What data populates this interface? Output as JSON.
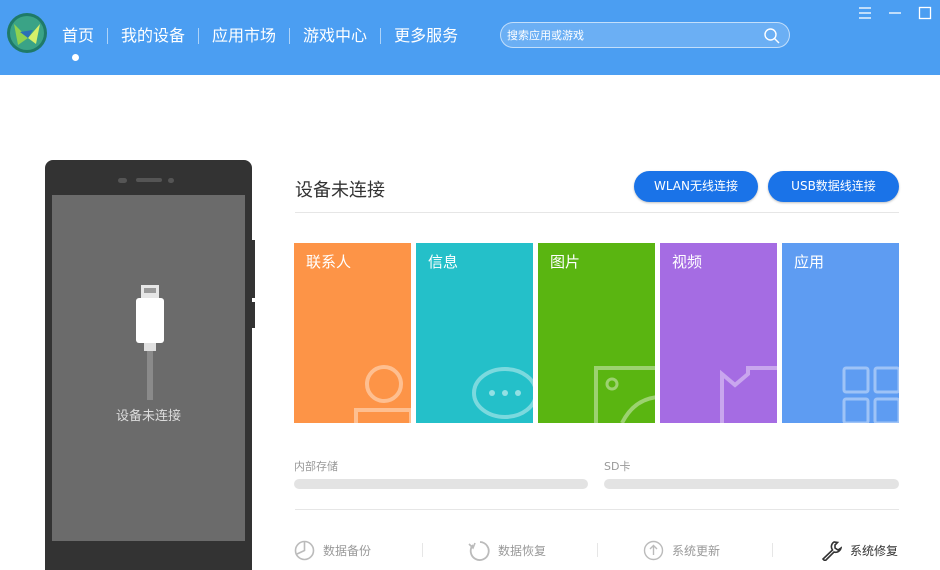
{
  "nav": {
    "items": [
      {
        "label": "首页"
      },
      {
        "label": "我的设备"
      },
      {
        "label": "应用市场"
      },
      {
        "label": "游戏中心"
      },
      {
        "label": "更多服务"
      }
    ],
    "active_index": 0
  },
  "search": {
    "placeholder": "搜索应用或游戏",
    "icon": "search-icon"
  },
  "window_controls": [
    "menu-icon",
    "minimize-icon",
    "maximize-icon"
  ],
  "device": {
    "status": "设备未连接",
    "screen_text": "设备未连接",
    "wlan_button": "WLAN无线连接",
    "usb_button": "USB数据线连接"
  },
  "tiles": [
    {
      "label": "联系人",
      "icon": "contact-icon",
      "color": "#fd9447"
    },
    {
      "label": "信息",
      "icon": "message-icon",
      "color": "#24c0c9"
    },
    {
      "label": "图片",
      "icon": "image-icon",
      "color": "#5ab511"
    },
    {
      "label": "视频",
      "icon": "video-icon",
      "color": "#a56ce3"
    },
    {
      "label": "应用",
      "icon": "apps-icon",
      "color": "#5e9cf2"
    }
  ],
  "storage": {
    "internal_label": "内部存储",
    "sd_label": "SD卡"
  },
  "tools": [
    {
      "label": "数据备份",
      "icon": "backup-icon"
    },
    {
      "label": "数据恢复",
      "icon": "restore-icon"
    },
    {
      "label": "系统更新",
      "icon": "update-icon"
    },
    {
      "label": "系统修复",
      "icon": "wrench-icon"
    }
  ],
  "colors": {
    "topbar": "#4b9ef2",
    "button": "#1a73e8",
    "phone": "#333333"
  }
}
